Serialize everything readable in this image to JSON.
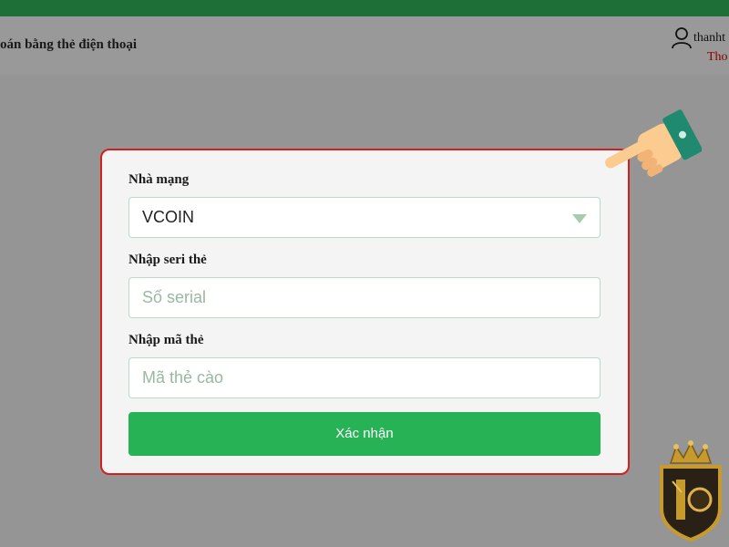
{
  "header": {
    "title": "oán bằng thẻ điện thoại",
    "username": "thanht",
    "logout": "Tho"
  },
  "form": {
    "network": {
      "label": "Nhà mạng",
      "value": "VCOIN"
    },
    "serial": {
      "label": "Nhập seri thẻ",
      "placeholder": "Số serial"
    },
    "code": {
      "label": "Nhập mã thẻ",
      "placeholder": "Mã thẻ cào"
    },
    "submit_label": "Xác nhận"
  },
  "icons": {
    "user": "user-icon",
    "dropdown": "chevron-down-icon",
    "pointer": "pointing-hand-icon",
    "logo": "crown-logo"
  },
  "colors": {
    "header_green": "#1e6e37",
    "overlay_gray": "#959595",
    "card_border": "#d41f1f",
    "button_green": "#27b255"
  }
}
